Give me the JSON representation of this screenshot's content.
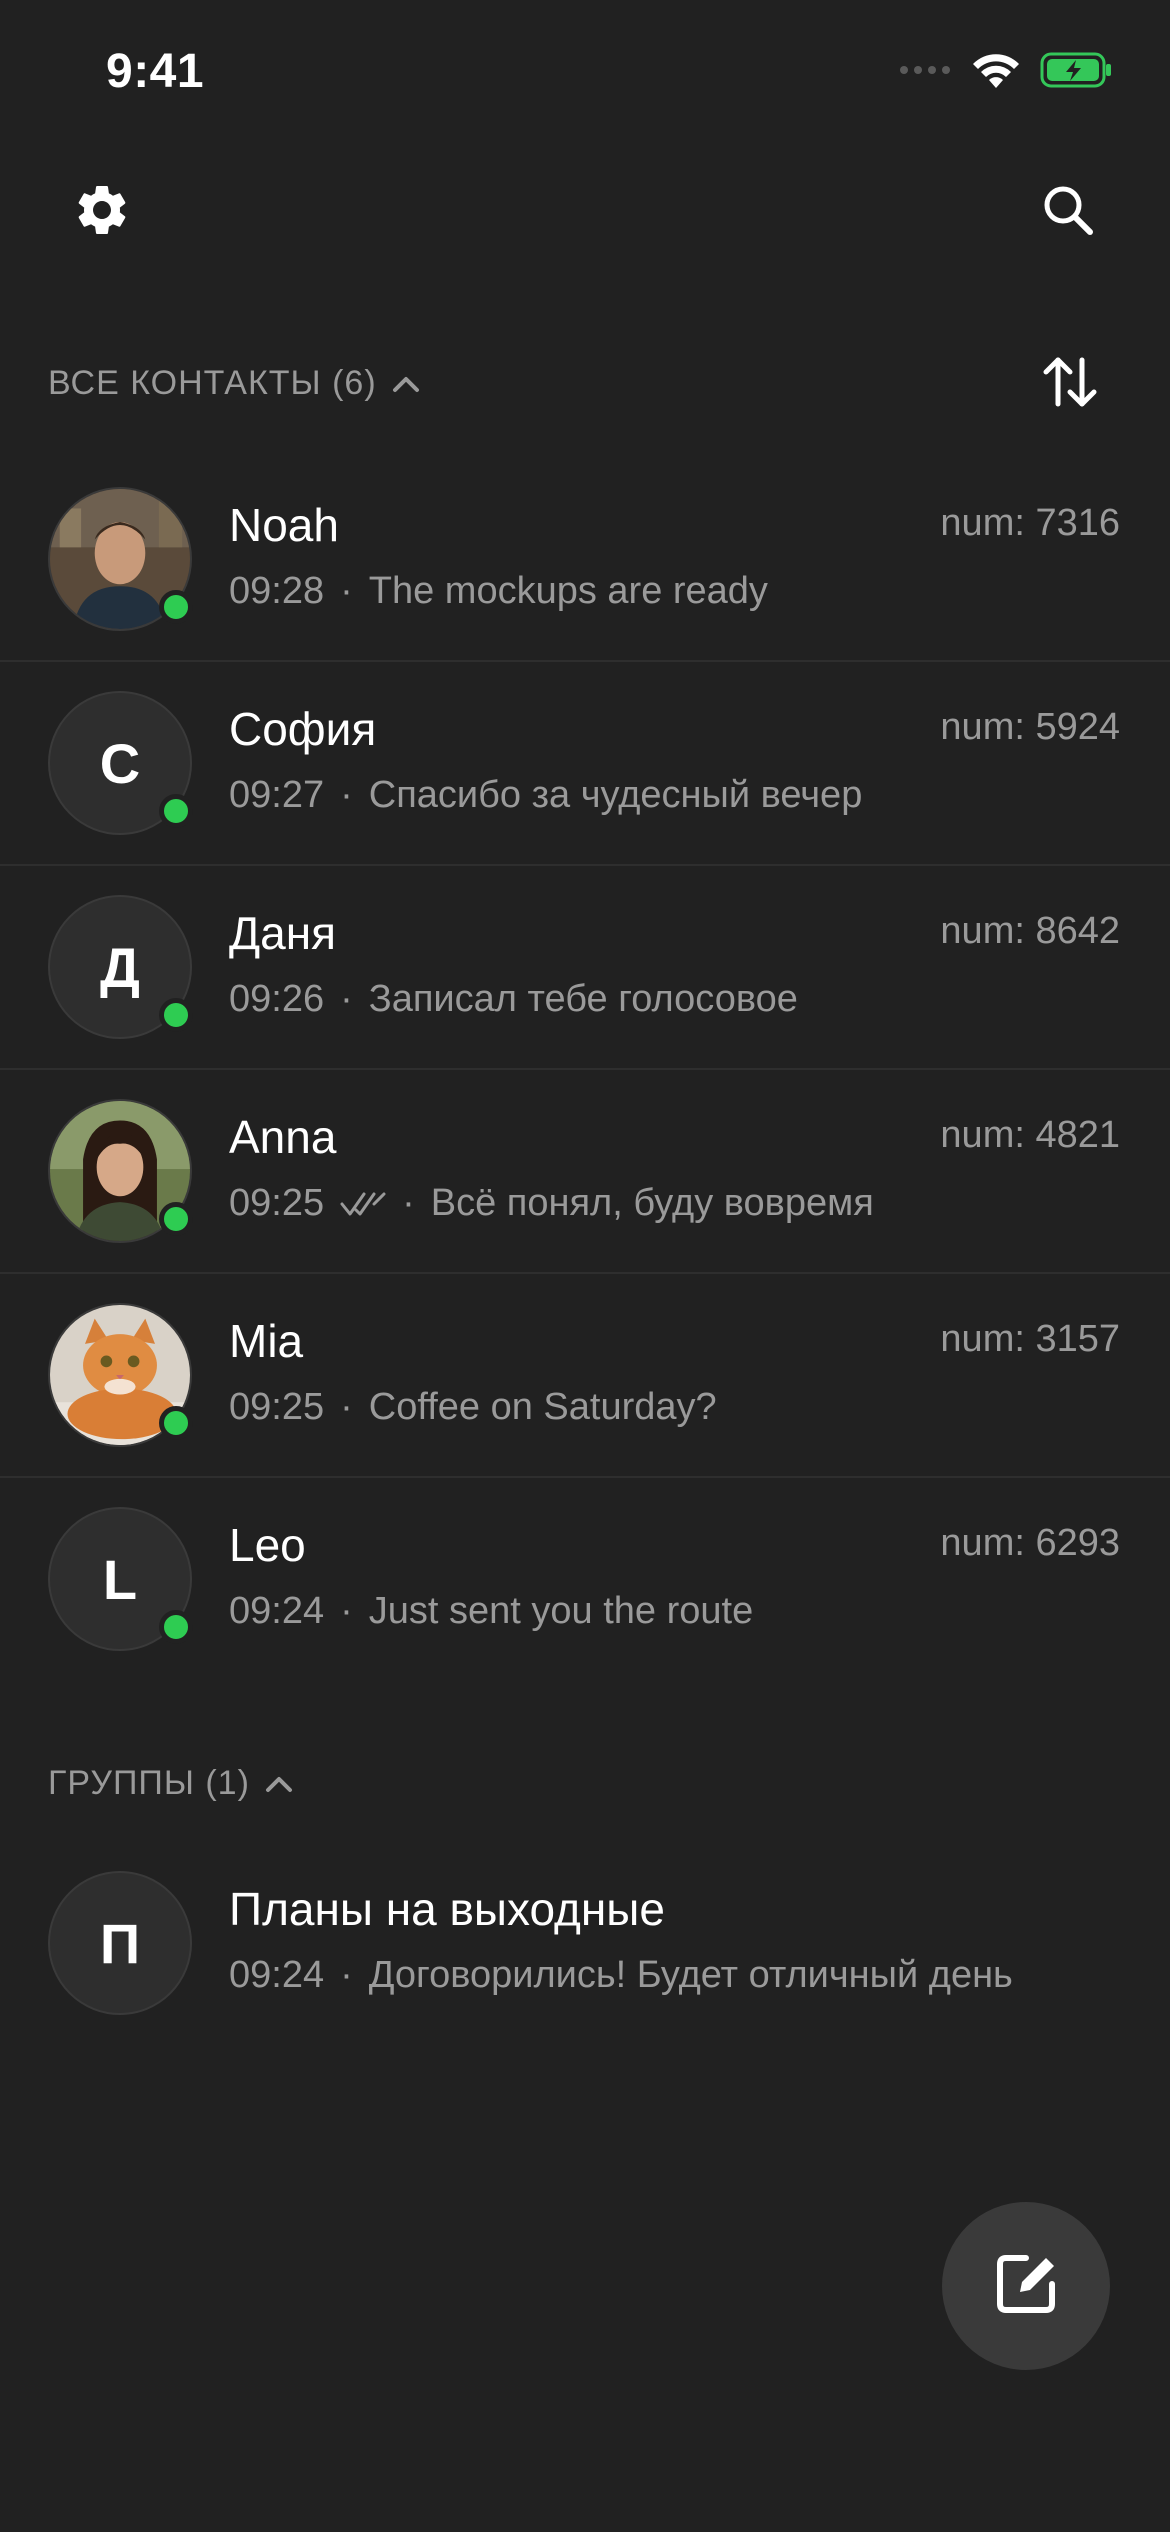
{
  "status_bar": {
    "time": "9:41",
    "battery_color": "#34c759"
  },
  "toolbar": {
    "settings_icon": "gear-icon",
    "search_icon": "search-icon",
    "sort_icon": "sort-arrows-icon"
  },
  "contacts_section": {
    "title": "ВСЕ КОНТАКТЫ (6)",
    "contacts": [
      {
        "name": "Noah",
        "num": "num: 7316",
        "time": "09:28",
        "message": "The mockups are ready",
        "avatar": "photo-man",
        "online": true
      },
      {
        "name": "София",
        "num": "num: 5924",
        "time": "09:27",
        "message": "Спасибо за чудесный вечер",
        "avatar_letter": "С",
        "online": true
      },
      {
        "name": "Даня",
        "num": "num: 8642",
        "time": "09:26",
        "message": "Записал тебе голосовое",
        "avatar_letter": "Д",
        "online": true
      },
      {
        "name": "Anna",
        "num": "num: 4821",
        "time": "09:25",
        "message": "Всё понял, буду вовремя",
        "avatar": "photo-woman",
        "online": true,
        "read_ticks": true
      },
      {
        "name": "Mia",
        "num": "num: 3157",
        "time": "09:25",
        "message": "Coffee on Saturday?",
        "avatar": "photo-cat",
        "online": true
      },
      {
        "name": "Leo",
        "num": "num: 6293",
        "time": "09:24",
        "message": "Just sent you the route",
        "avatar_letter": "L",
        "online": true
      }
    ]
  },
  "groups_section": {
    "title": "ГРУППЫ (1)",
    "groups": [
      {
        "name": "Планы на выходные",
        "time": "09:24",
        "message": "Договорились! Будет отличный день",
        "avatar_letter": "П"
      }
    ]
  },
  "fab": {
    "icon": "compose-icon"
  },
  "colors": {
    "background": "#212121",
    "online": "#2ecc52",
    "secondary_text": "#9a9a9a",
    "fab": "#3a3a3a"
  },
  "separator": "·"
}
